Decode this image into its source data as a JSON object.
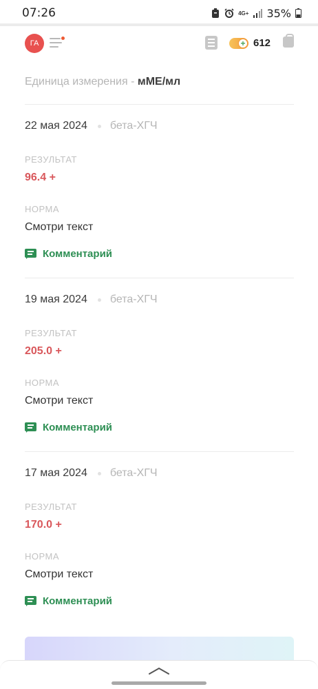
{
  "status_bar": {
    "time": "07:26",
    "network": "4G+",
    "battery": "35%"
  },
  "header": {
    "avatar_initials": "ГА",
    "coins": "612",
    "accent_color": "#e8514f",
    "coin_color": "#f29a3a"
  },
  "unit": {
    "label": "Единица измерения - ",
    "value": "мМЕ/мл"
  },
  "entries": [
    {
      "date": "22 мая 2024",
      "test": "бета-ХГЧ",
      "result_label": "РЕЗУЛЬТАТ",
      "result": "96.4 +",
      "norm_label": "НОРМА",
      "norm": "Смотри текст",
      "comment_label": "Комментарий"
    },
    {
      "date": "19 мая 2024",
      "test": "бета-ХГЧ",
      "result_label": "РЕЗУЛЬТАТ",
      "result": "205.0 +",
      "norm_label": "НОРМА",
      "norm": "Смотри текст",
      "comment_label": "Комментарий"
    },
    {
      "date": "17 мая 2024",
      "test": "бета-ХГЧ",
      "result_label": "РЕЗУЛЬТАТ",
      "result": "170.0 +",
      "norm_label": "НОРМА",
      "norm": "Смотри текст",
      "comment_label": "Комментарий"
    }
  ],
  "colors": {
    "result": "#d9575b",
    "comment": "#2e8f54"
  }
}
